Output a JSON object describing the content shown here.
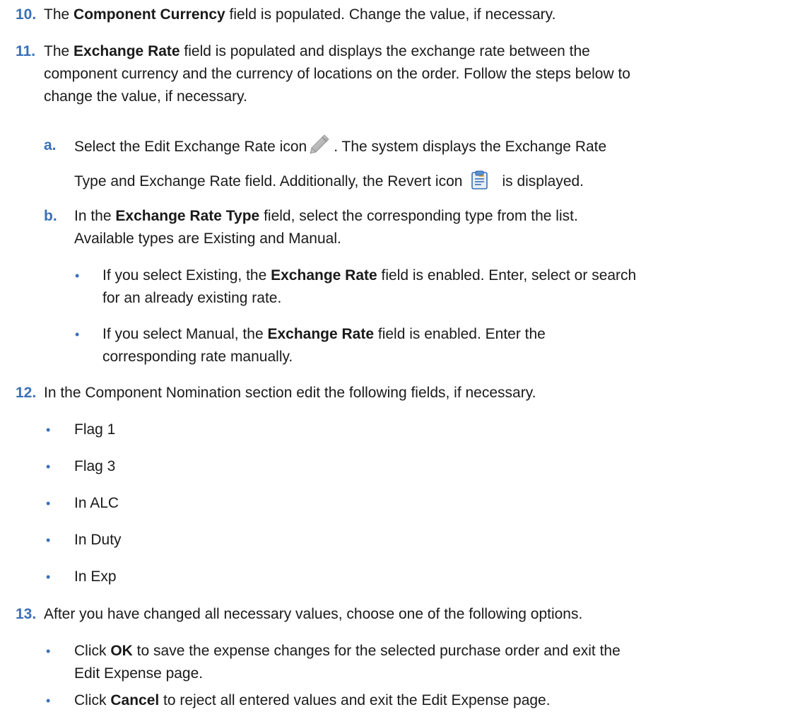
{
  "steps": {
    "s10": {
      "num": "10.",
      "pre": "The ",
      "bold": "Component Currency",
      "post": " field is populated. Change the value, if necessary."
    },
    "s11": {
      "num": "11.",
      "pre": "The ",
      "bold": "Exchange Rate",
      "l1_post": " field is populated and displays the exchange rate between the",
      "l2": "component currency and the currency of locations on the order. Follow the steps below to",
      "l3": "change the value, if necessary.",
      "a": {
        "label": "a.",
        "pre": "Select the Edit Exchange Rate icon",
        "post": ". The system displays the Exchange Rate",
        "l2_pre": "Type and Exchange Rate field. Additionally, the Revert icon",
        "l2_post": "is displayed."
      },
      "b": {
        "label": "b.",
        "pre": "In the ",
        "bold": "Exchange Rate Type",
        "post": " field, select the corresponding type from the list.",
        "l2": "Available types are Existing and Manual.",
        "bullet1": {
          "pre": "If you select Existing, the ",
          "bold": "Exchange Rate",
          "post": " field is enabled. Enter, select or search",
          "l2": "for an already existing rate."
        },
        "bullet2": {
          "pre": "If you select Manual, the ",
          "bold": "Exchange Rate",
          "post": " field is enabled. Enter the",
          "l2": "corresponding rate manually."
        }
      }
    },
    "s12": {
      "num": "12.",
      "text": "In the Component Nomination section edit the following fields, if necessary.",
      "items": [
        "Flag 1",
        "Flag 3",
        "In ALC",
        "In Duty",
        "In Exp"
      ]
    },
    "s13": {
      "num": "13.",
      "text": "After you have changed all necessary values, choose one of the following options.",
      "ok": {
        "pre": "Click ",
        "bold": "OK",
        "post": " to save the expense changes for the selected purchase order and exit the",
        "l2": "Edit Expense page."
      },
      "cancel": {
        "pre": "Click ",
        "bold": "Cancel",
        "post": " to reject all entered values and exit the Edit Expense page."
      }
    }
  },
  "bullet_glyph": "•",
  "colors": {
    "number": "#3b6fb6",
    "text": "#1a1a1a"
  },
  "icons": [
    "pencil-icon",
    "revert-icon"
  ]
}
